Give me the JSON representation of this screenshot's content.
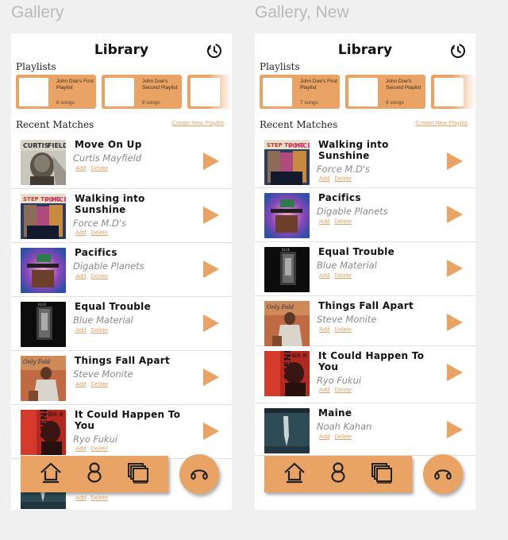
{
  "frames": [
    {
      "label": "Gallery",
      "title": "Library",
      "playlists_label": "Playlists",
      "recent_label": "Recent Matches",
      "create_link": "Create New Playlist",
      "playlists": [
        {
          "name": "John Doe's First Playlist",
          "count": "6 songs"
        },
        {
          "name": "John Doe's Second Playlist",
          "count": "8 songs"
        }
      ],
      "songs": [
        {
          "title": "Move On Up",
          "artist": "Curtis Mayfield",
          "add": "Add",
          "delete": "Delete",
          "cover": "move-on-up"
        },
        {
          "title": "Walking into Sunshine",
          "artist": "Force M.D's",
          "add": "Add",
          "delete": "Delete",
          "cover": "walking"
        },
        {
          "title": "Pacifics",
          "artist": "Digable Planets",
          "add": "Add",
          "delete": "Delete",
          "cover": "pacifics"
        },
        {
          "title": "Equal Trouble",
          "artist": "Blue Material",
          "add": "Add",
          "delete": "Delete",
          "cover": "equal"
        },
        {
          "title": "Things Fall Apart",
          "artist": "Steve Monite",
          "add": "Add",
          "delete": "Delete",
          "cover": "things"
        },
        {
          "title": "It Could Happen To You",
          "artist": "Ryo Fukui",
          "add": "Add",
          "delete": "Delete",
          "cover": "scenery"
        },
        {
          "title": "",
          "artist": "",
          "add": "Add",
          "delete": "Delete",
          "cover": "maine"
        }
      ]
    },
    {
      "label": "Gallery, New",
      "title": "Library",
      "playlists_label": "Playlists",
      "recent_label": "Recent Matches",
      "create_link": "Create New Playlist",
      "playlists": [
        {
          "name": "John Doe's First Playlist",
          "count": "7 songs"
        },
        {
          "name": "John Doe's Second Playlist",
          "count": "8 songs"
        }
      ],
      "songs": [
        {
          "title": "Walking into Sunshine",
          "artist": "Force M.D's",
          "add": "Add",
          "delete": "Delete",
          "cover": "walking"
        },
        {
          "title": "Pacifics",
          "artist": "Digable Planets",
          "add": "Add",
          "delete": "Delete",
          "cover": "pacifics"
        },
        {
          "title": "Equal Trouble",
          "artist": "Blue Material",
          "add": "Add",
          "delete": "Delete",
          "cover": "equal"
        },
        {
          "title": "Things Fall Apart",
          "artist": "Steve Monite",
          "add": "Add",
          "delete": "Delete",
          "cover": "things"
        },
        {
          "title": "It Could Happen To You",
          "artist": "Ryo Fukui",
          "add": "Add",
          "delete": "Delete",
          "cover": "scenery"
        },
        {
          "title": "Maine",
          "artist": "Noah Kahan",
          "add": "Add",
          "delete": "Delete",
          "cover": "maine"
        }
      ]
    }
  ],
  "nav": {
    "icons": [
      "home-icon",
      "figure-eight-icon",
      "stacked-pages-icon"
    ],
    "fab_icon": "headphones-icon"
  },
  "colors": {
    "accent": "#e9a465",
    "background": "#f0f0f0",
    "card": "#ffffff",
    "title_text": "#111111",
    "artist_text": "#8a8a8a"
  }
}
